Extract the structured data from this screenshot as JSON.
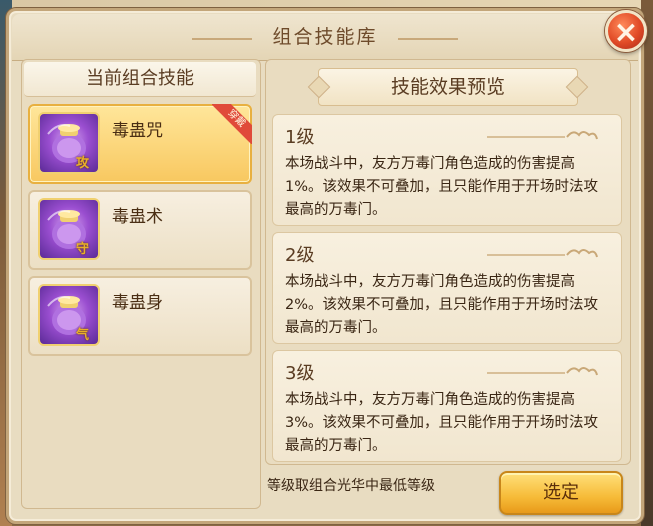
{
  "window": {
    "title": "组合技能库",
    "close_label": "×"
  },
  "left_panel": {
    "header": "当前组合技能",
    "skills": [
      {
        "name": "毒蛊咒",
        "mark": "攻",
        "ribbon": "穿戴",
        "selected": true
      },
      {
        "name": "毒蛊术",
        "mark": "守",
        "ribbon": "",
        "selected": false
      },
      {
        "name": "毒蛊身",
        "mark": "气",
        "ribbon": "",
        "selected": false
      }
    ]
  },
  "right_panel": {
    "header": "技能效果预览",
    "levels": [
      {
        "title": "1级",
        "desc": "本场战斗中，友方万毒门角色造成的伤害提高1%。该效果不可叠加，且只能作用于开场时法攻最高的万毒门。"
      },
      {
        "title": "2级",
        "desc": "本场战斗中，友方万毒门角色造成的伤害提高2%。该效果不可叠加，且只能作用于开场时法攻最高的万毒门。"
      },
      {
        "title": "3级",
        "desc": "本场战斗中，友方万毒门角色造成的伤害提高3%。该效果不可叠加，且只能作用于开场时法攻最高的万毒门。"
      }
    ]
  },
  "footer": {
    "note": "等级取组合光华中最低等级",
    "select_label": "选定"
  },
  "colors": {
    "panel_bg": "#e9dcc0",
    "selected_bg": "#f8c860",
    "close_red": "#e04a26",
    "button_gold": "#f6bb38"
  }
}
